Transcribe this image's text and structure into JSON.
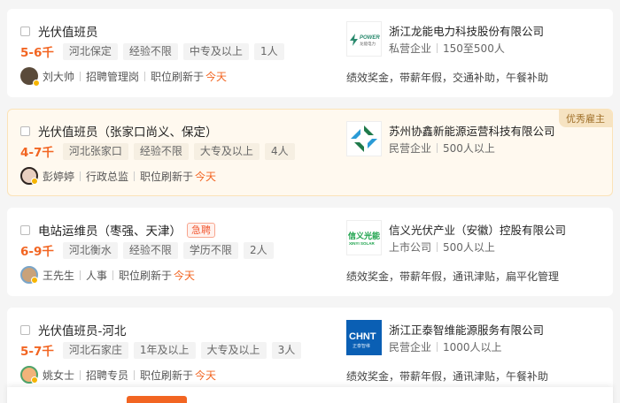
{
  "jobs": [
    {
      "title": "光伏值班员",
      "urgent": "",
      "salary": "5-6千",
      "tags": [
        "河北保定",
        "经验不限",
        "中专及以上",
        "1人"
      ],
      "recruiter_name": "刘大帅",
      "recruiter_role": "招聘管理岗",
      "refresh_label": "职位刷新于",
      "refresh_time": "今天",
      "company": "浙江龙能电力科技股份有限公司",
      "company_type": "私营企业",
      "company_size": "150至500人",
      "welfare": "绩效奖金，带薪年假，交通补助，午餐补助",
      "badge": ""
    },
    {
      "title": "光伏值班员（张家口尚义、保定）",
      "urgent": "",
      "salary": "4-7千",
      "tags": [
        "河北张家口",
        "经验不限",
        "大专及以上",
        "4人"
      ],
      "recruiter_name": "彭婷婷",
      "recruiter_role": "行政总监",
      "refresh_label": "职位刷新于",
      "refresh_time": "今天",
      "company": "苏州协鑫新能源运营科技有限公司",
      "company_type": "民营企业",
      "company_size": "500人以上",
      "welfare": "",
      "badge": "优秀雇主"
    },
    {
      "title": "电站运维员（枣强、天津）",
      "urgent": "急聘",
      "salary": "6-9千",
      "tags": [
        "河北衡水",
        "经验不限",
        "学历不限",
        "2人"
      ],
      "recruiter_name": "王先生",
      "recruiter_role": "人事",
      "refresh_label": "职位刷新于",
      "refresh_time": "今天",
      "company": "信义光伏产业（安徽）控股有限公司",
      "company_type": "上市公司",
      "company_size": "500人以上",
      "welfare": "绩效奖金，带薪年假，通讯津贴，扁平化管理",
      "badge": ""
    },
    {
      "title": "光伏值班员-河北",
      "urgent": "",
      "salary": "5-7千",
      "tags": [
        "河北石家庄",
        "1年及以上",
        "大专及以上",
        "3人"
      ],
      "recruiter_name": "姚女士",
      "recruiter_role": "招聘专员",
      "refresh_label": "职位刷新于",
      "refresh_time": "今天",
      "company": "浙江正泰智维能源服务有限公司",
      "company_type": "民营企业",
      "company_size": "1000人以上",
      "welfare": "绩效奖金，带薪年假，通讯津贴，午餐补助",
      "badge": ""
    }
  ],
  "logos": {
    "logo0": {
      "text": "POWER",
      "sub": "龙能电力",
      "color": "#2a8a6e"
    },
    "logo1": {
      "color": "#1f7a4a"
    },
    "logo2": {
      "text": "信义光能",
      "sub": "XINYI SOLAR",
      "color": "#1aa24a"
    },
    "logo3": {
      "text": "CHNT",
      "sub": "正泰智维",
      "color": "#0a5fb4"
    }
  }
}
